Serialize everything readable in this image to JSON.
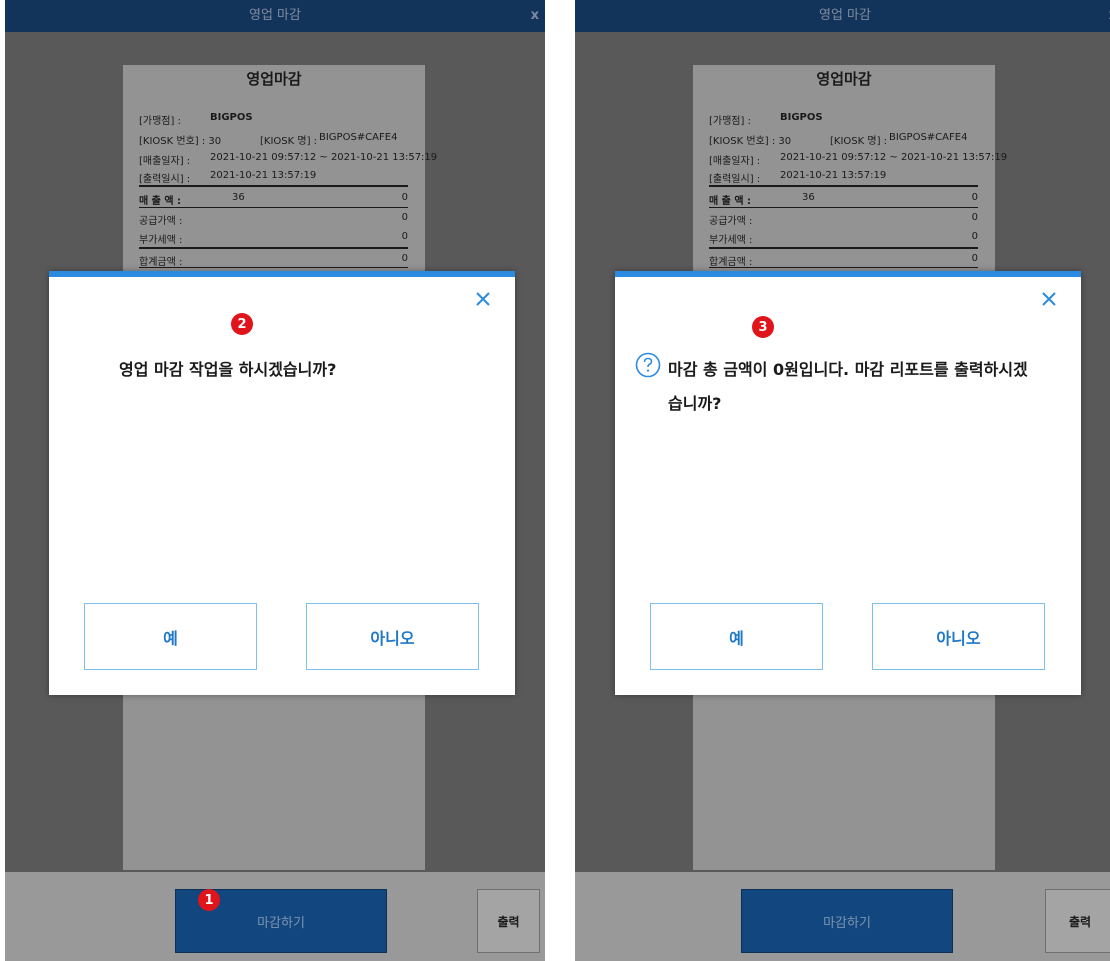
{
  "window_title": "영업 마감",
  "close_label": "x",
  "receipt": {
    "title": "영업마감",
    "store_label": "[가맹점]  :",
    "store_value": "BIGPOS",
    "kiosk_no_label": "[KIOSK 번호] : 30",
    "kiosk_name_label": "[KIOSK 명] :",
    "kiosk_name_value": "BIGPOS#CAFE4",
    "sales_period_label": "[매출일자]  :",
    "sales_period_value": "2021-10-21 09:57:12 ~ 2021-10-21 13:57:19",
    "print_time_label": "[출력일시]  :",
    "print_time_value": "2021-10-21 13:57:19",
    "sales_amount_label": "매 출 액 :",
    "sales_count": "36",
    "sales_amount": "0",
    "supply_label": "공급가액 :",
    "supply_amount": "0",
    "vat_label": "부가세액 :",
    "vat_amount": "0",
    "total_label": "합계금액 :",
    "total_amount": "0"
  },
  "footer": {
    "close_button": "마감하기",
    "print_button": "출력"
  },
  "dialog_left": {
    "message": "영업 마감 작업을 하시겠습니까?",
    "yes": "예",
    "no": "아니오"
  },
  "dialog_right": {
    "message": "마감 총 금액이 0원입니다. 마감 리포트를 출력하시겠습니까?",
    "yes": "예",
    "no": "아니오"
  },
  "badges": {
    "step1": "1",
    "step2": "2",
    "step3": "3"
  },
  "colors": {
    "accent": "#2a8be0",
    "titlebar": "#12345a",
    "badge": "#e0141b",
    "primary_button": "#12467e"
  }
}
